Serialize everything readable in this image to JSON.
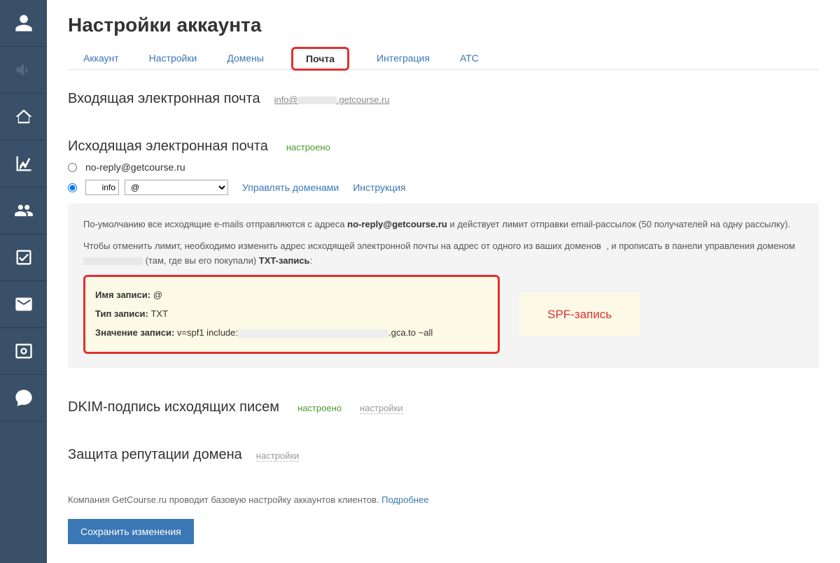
{
  "header": {
    "title": "Настройки аккаунта"
  },
  "tabs": [
    {
      "label": "Аккаунт"
    },
    {
      "label": "Настройки"
    },
    {
      "label": "Домены"
    },
    {
      "label": "Почта",
      "active": true
    },
    {
      "label": "Интеграция"
    },
    {
      "label": "АТС"
    }
  ],
  "incoming": {
    "title": "Входящая электронная почта",
    "email_prefix": "info@",
    "email_suffix": ".getcourse.ru"
  },
  "outgoing": {
    "title": "Исходящая электронная почта",
    "status": "настроено",
    "option_noreply": "no-reply@getcourse.ru",
    "local_value": "info",
    "domain_at": "@",
    "manage_domains": "Управлять доменами",
    "instruction": "Инструкция",
    "info_line1_a": "По-умолчанию все исходящие e-mails отправляются с адреса ",
    "info_line1_bold": "no-reply@getcourse.ru",
    "info_line1_b": " и действует лимит отправки email-рассылок (50 получателей на одну рассылку).",
    "info_line2_a": "Чтобы отменить лимит, необходимо изменить адрес исходящей электронной почты на адрес от одного из ваших доменов",
    "info_line2_b": ", и прописать в панели управления доменом ",
    "info_line2_c": "(там, где вы его покупали) ",
    "info_line2_txt": "TXT-запись",
    "spf": {
      "name_label": "Имя записи:",
      "name_value": "@",
      "type_label": "Тип записи:",
      "type_value": "TXT",
      "value_label": "Значение записи:",
      "value_prefix": "v=spf1 include:",
      "value_suffix": ".gca.to ~all",
      "annotation": "SPF-запись"
    }
  },
  "dkim": {
    "title": "DKIM-подпись исходящих писем",
    "status": "настроено",
    "settings": "настройки"
  },
  "reputation": {
    "title": "Защита репутации домена",
    "settings": "настройки"
  },
  "footer": {
    "text": "Компания GetCourse.ru проводит базовую настройку аккаунтов клиентов. ",
    "more": "Подробнее",
    "save": "Сохранить изменения"
  }
}
